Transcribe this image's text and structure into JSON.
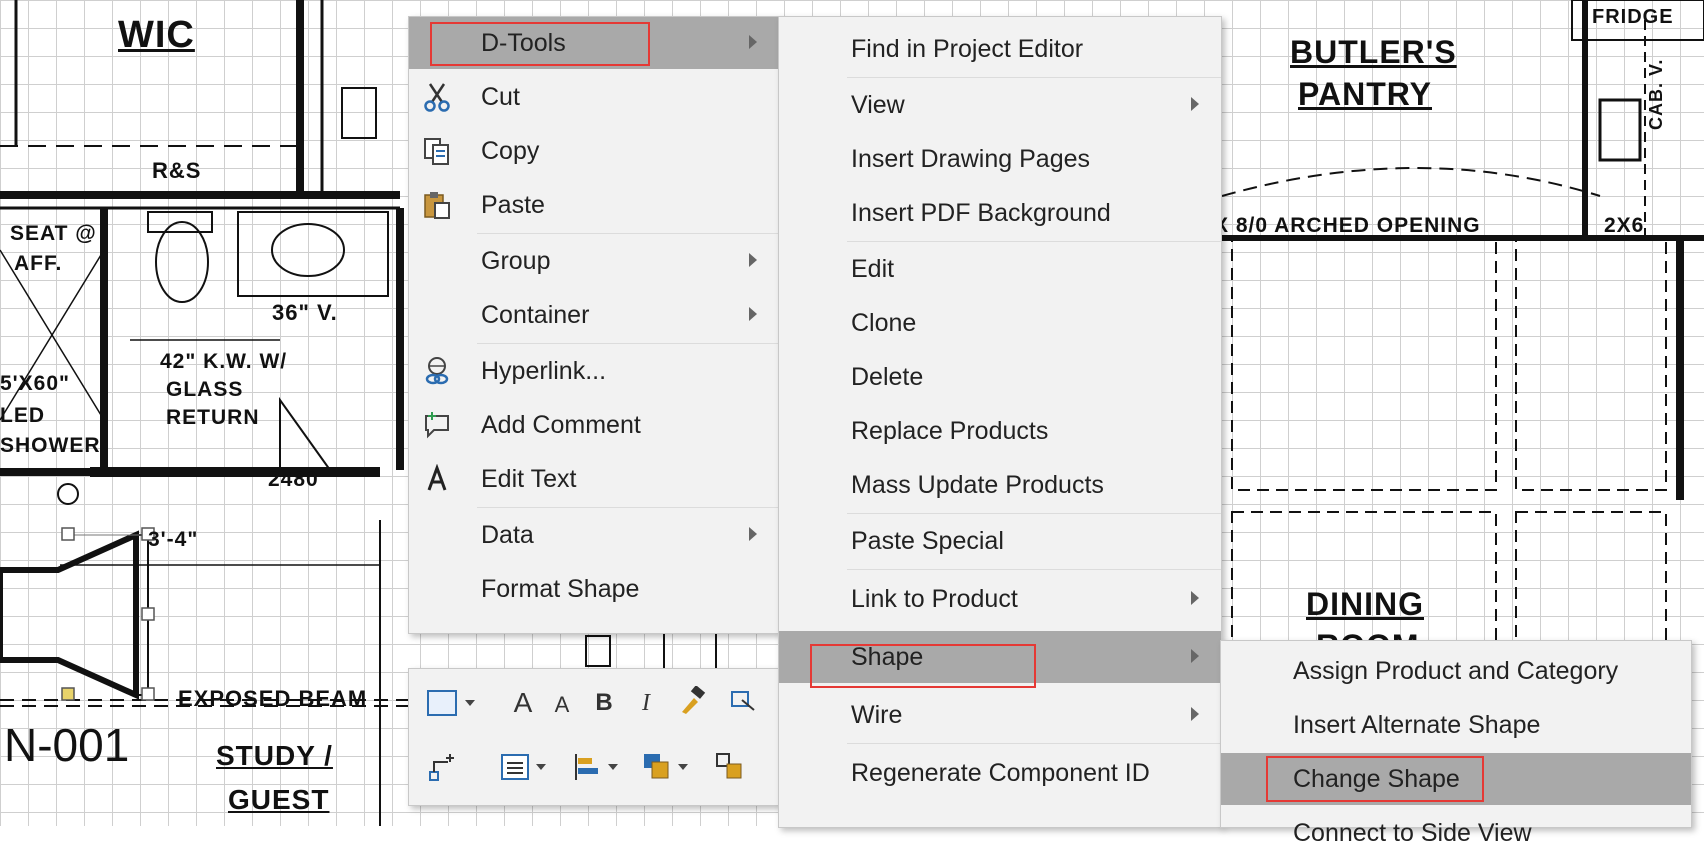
{
  "drawing": {
    "labels": {
      "wic": "WIC",
      "rs": "R&S",
      "seat": "SEAT @",
      "aff": "AFF.",
      "v36": "36\" V.",
      "kw": "42\" K.W. W/",
      "glass": "GLASS",
      "return": "RETURN",
      "x60": "5'X60\"",
      "led": "LED",
      "shower": "SHOWER",
      "d2480": "2480",
      "dim34": "3'-4\"",
      "beam": "EXPOSED BEAM",
      "code": "N-001",
      "study": "STUDY /",
      "guest": "GUEST",
      "butlers": "BUTLER'S",
      "pantry": "PANTRY",
      "arched": "X 8/0 ARCHED OPENING",
      "x26": "2X6",
      "dining": "DINING",
      "fridge": "FRIDGE",
      "cabv": "CAB. V.",
      "room": "ROOM"
    }
  },
  "context_menu": {
    "items": [
      {
        "label": "D-Tools",
        "icon": "",
        "submenu": true,
        "active": true
      },
      {
        "label": "Cut",
        "icon": "scissors-icon",
        "submenu": false
      },
      {
        "label": "Copy",
        "icon": "copy-icon",
        "submenu": false
      },
      {
        "label": "Paste",
        "icon": "paste-icon",
        "submenu": false
      },
      {
        "label": "Group",
        "icon": "",
        "submenu": true
      },
      {
        "label": "Container",
        "icon": "",
        "submenu": true
      },
      {
        "label": "Hyperlink...",
        "icon": "hyperlink-icon",
        "submenu": false
      },
      {
        "label": "Add Comment",
        "icon": "comment-icon",
        "submenu": false
      },
      {
        "label": "Edit Text",
        "icon": "text-icon",
        "submenu": false
      },
      {
        "label": "Data",
        "icon": "",
        "submenu": true
      },
      {
        "label": "Format Shape",
        "icon": "",
        "submenu": false
      }
    ]
  },
  "dtools_submenu": {
    "items": [
      {
        "label": "Find in Project Editor",
        "submenu": false
      },
      {
        "label": "View",
        "submenu": true
      },
      {
        "label": "Insert Drawing Pages",
        "submenu": false
      },
      {
        "label": "Insert PDF Background",
        "submenu": false
      },
      {
        "label": "Edit",
        "submenu": false
      },
      {
        "label": "Clone",
        "submenu": false
      },
      {
        "label": "Delete",
        "submenu": false
      },
      {
        "label": "Replace Products",
        "submenu": false
      },
      {
        "label": "Mass Update Products",
        "submenu": false
      },
      {
        "label": "Paste Special",
        "submenu": false
      },
      {
        "label": "Link to Product",
        "submenu": true
      },
      {
        "label": "Shape",
        "submenu": true,
        "active": true
      },
      {
        "label": "Wire",
        "submenu": true
      },
      {
        "label": "Regenerate Component ID",
        "submenu": false
      }
    ]
  },
  "shape_submenu": {
    "items": [
      {
        "label": "Assign Product and Category"
      },
      {
        "label": "Insert Alternate Shape"
      },
      {
        "label": "Change Shape",
        "active": true
      },
      {
        "label": "Connect to Side View"
      }
    ]
  },
  "mini_toolbar": {
    "bold": "B",
    "italic": "I",
    "grow_font": "A",
    "shrink_font": "A"
  },
  "colors": {
    "menu_bg": "#f2f2f2",
    "highlight": "#a9a9a9",
    "callout": "#e53935"
  }
}
